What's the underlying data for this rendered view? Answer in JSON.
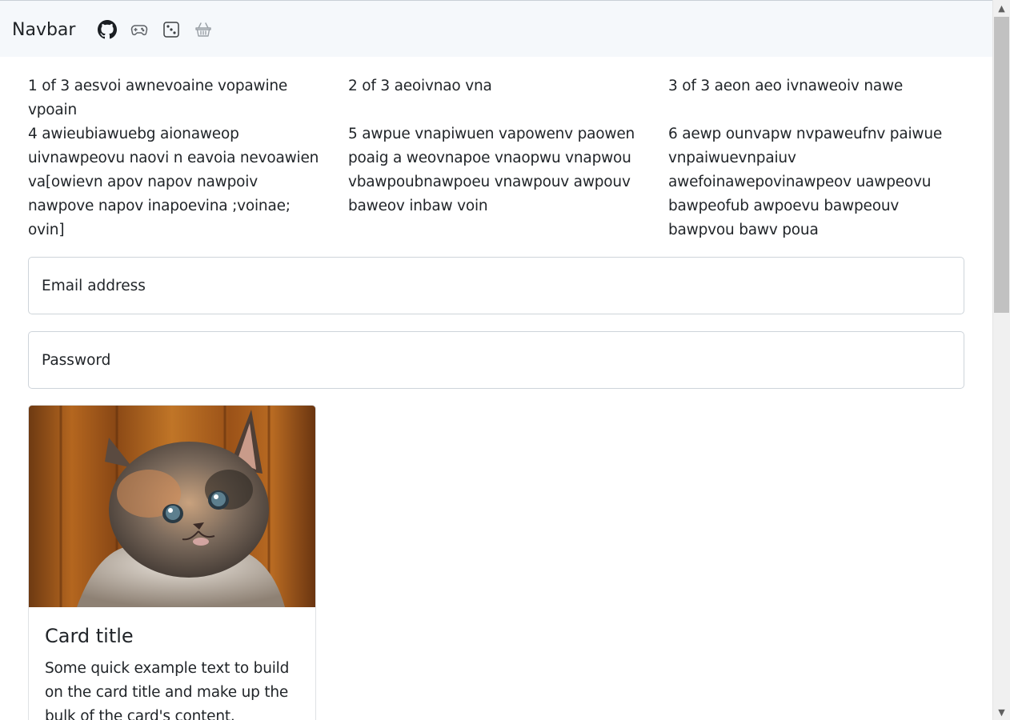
{
  "navbar": {
    "brand": "Navbar",
    "icons": [
      "github-icon",
      "gamepad-icon",
      "dice-icon",
      "basket-icon"
    ]
  },
  "columns": [
    {
      "line1": "1 of 3 aesvoi awnevoaine vopawine vpoain",
      "line2": "4 awieubiawuebg aionaweop uivnawpeovu naovi n eavoia nevoawien va[owievn apov napov nawpoiv nawpove napov inapoevina ;voinae; ovin]"
    },
    {
      "line1": "2 of 3 aeoivnao vna",
      "line2": "5 awpue vnapiwuen vapowenv paowen poaig a weovnapoe vnaopwu vnapwou vbawpoubnawpoeu vnawpouv awpouv baweov inbaw voin"
    },
    {
      "line1": "3 of 3 aeon aeo ivnaweoiv nawe",
      "line2": "6 aewp ounvapw nvpaweufnv paiwue vnpaiwuevnpaiuv awefoinawepovinawpeov uawpeovu bawpeofub awpoevu bawpeouv bawpvou bawv poua"
    }
  ],
  "form": {
    "email_placeholder": "Email address",
    "password_placeholder": "Password"
  },
  "card": {
    "title": "Card title",
    "text": "Some quick example text to build on the card title and make up the bulk of the card's content."
  },
  "colors": {
    "navbar_bg": "#f5f8fb",
    "text": "#212529",
    "border": "#ced4da"
  }
}
